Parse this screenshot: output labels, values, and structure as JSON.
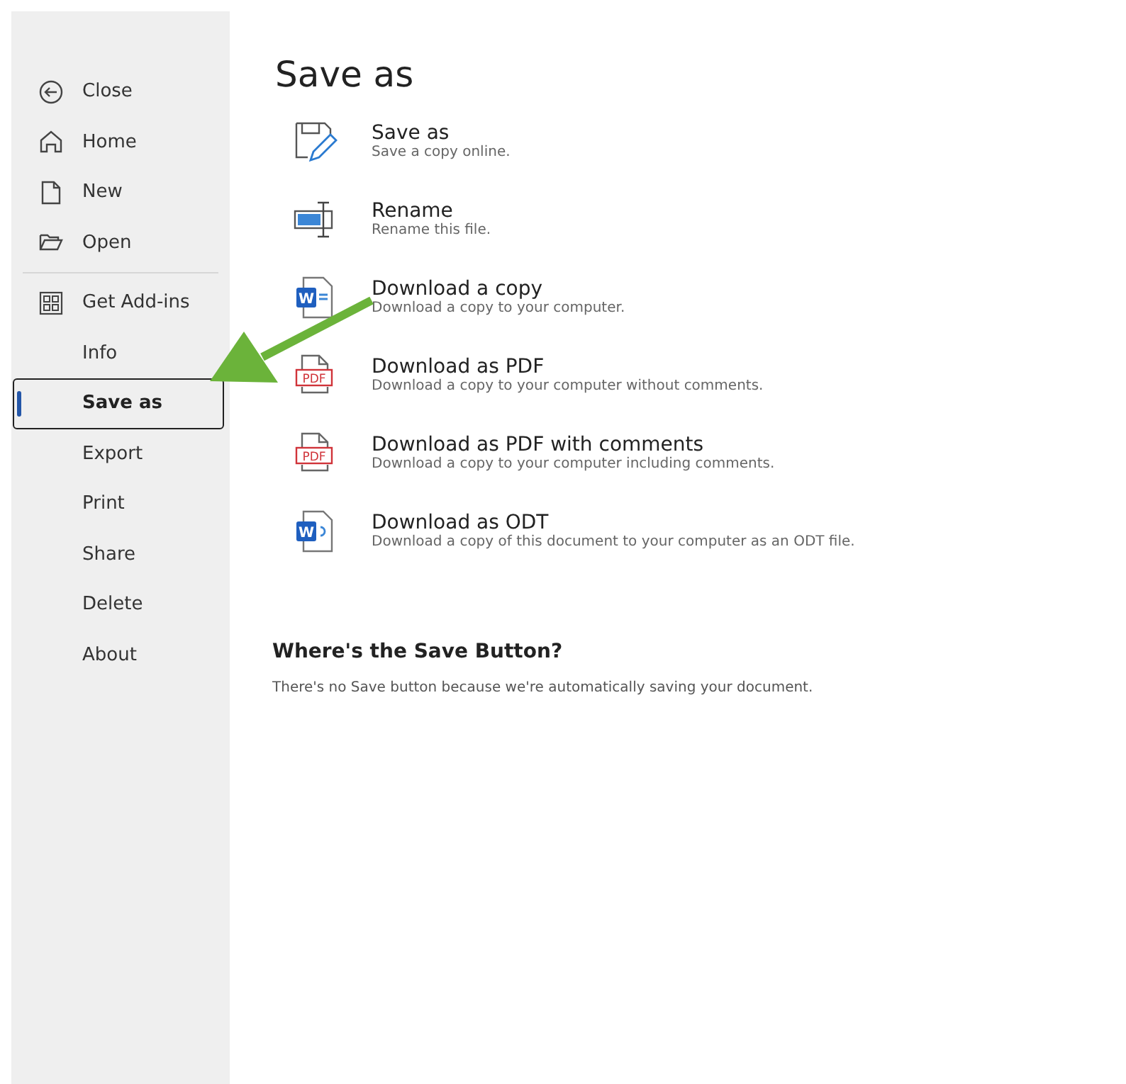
{
  "sidebar": {
    "items": [
      {
        "label": "Close",
        "kind": "back",
        "selected": false
      },
      {
        "label": "Home",
        "kind": "home",
        "selected": false
      },
      {
        "label": "New",
        "kind": "new",
        "selected": false
      },
      {
        "label": "Open",
        "kind": "open",
        "selected": false
      },
      {
        "kind": "divider"
      },
      {
        "label": "Get Add-ins",
        "kind": "addins",
        "selected": false
      },
      {
        "label": "Info",
        "kind": "plain",
        "selected": false
      },
      {
        "label": "Save as",
        "kind": "plain",
        "selected": true
      },
      {
        "label": "Export",
        "kind": "plain",
        "selected": false
      },
      {
        "label": "Print",
        "kind": "plain",
        "selected": false
      },
      {
        "label": "Share",
        "kind": "plain",
        "selected": false
      },
      {
        "label": "Delete",
        "kind": "plain",
        "selected": false
      },
      {
        "label": "About",
        "kind": "plain",
        "selected": false
      }
    ]
  },
  "main": {
    "title": "Save as",
    "options": [
      {
        "kind": "save",
        "title": "Save as",
        "description": "Save a copy online."
      },
      {
        "kind": "rename",
        "title": "Rename",
        "description": "Rename this file."
      },
      {
        "kind": "word",
        "icon_text": "W",
        "title": "Download a copy",
        "description": "Download a copy to your computer."
      },
      {
        "kind": "pdf",
        "icon_text": "PDF",
        "title": "Download as PDF",
        "description": "Download a copy to your computer without comments."
      },
      {
        "kind": "pdf",
        "icon_text": "PDF",
        "title": "Download as PDF with comments",
        "description": "Download a copy to your computer including comments."
      },
      {
        "kind": "odt",
        "icon_text": "W",
        "title": "Download as ODT",
        "description": "Download a copy of this document to your computer as an ODT file."
      }
    ],
    "note": {
      "heading": "Where's the Save Button?",
      "text": "There's no Save button because we're automatically saving your document."
    }
  },
  "annotation": {
    "kind": "arrow"
  }
}
